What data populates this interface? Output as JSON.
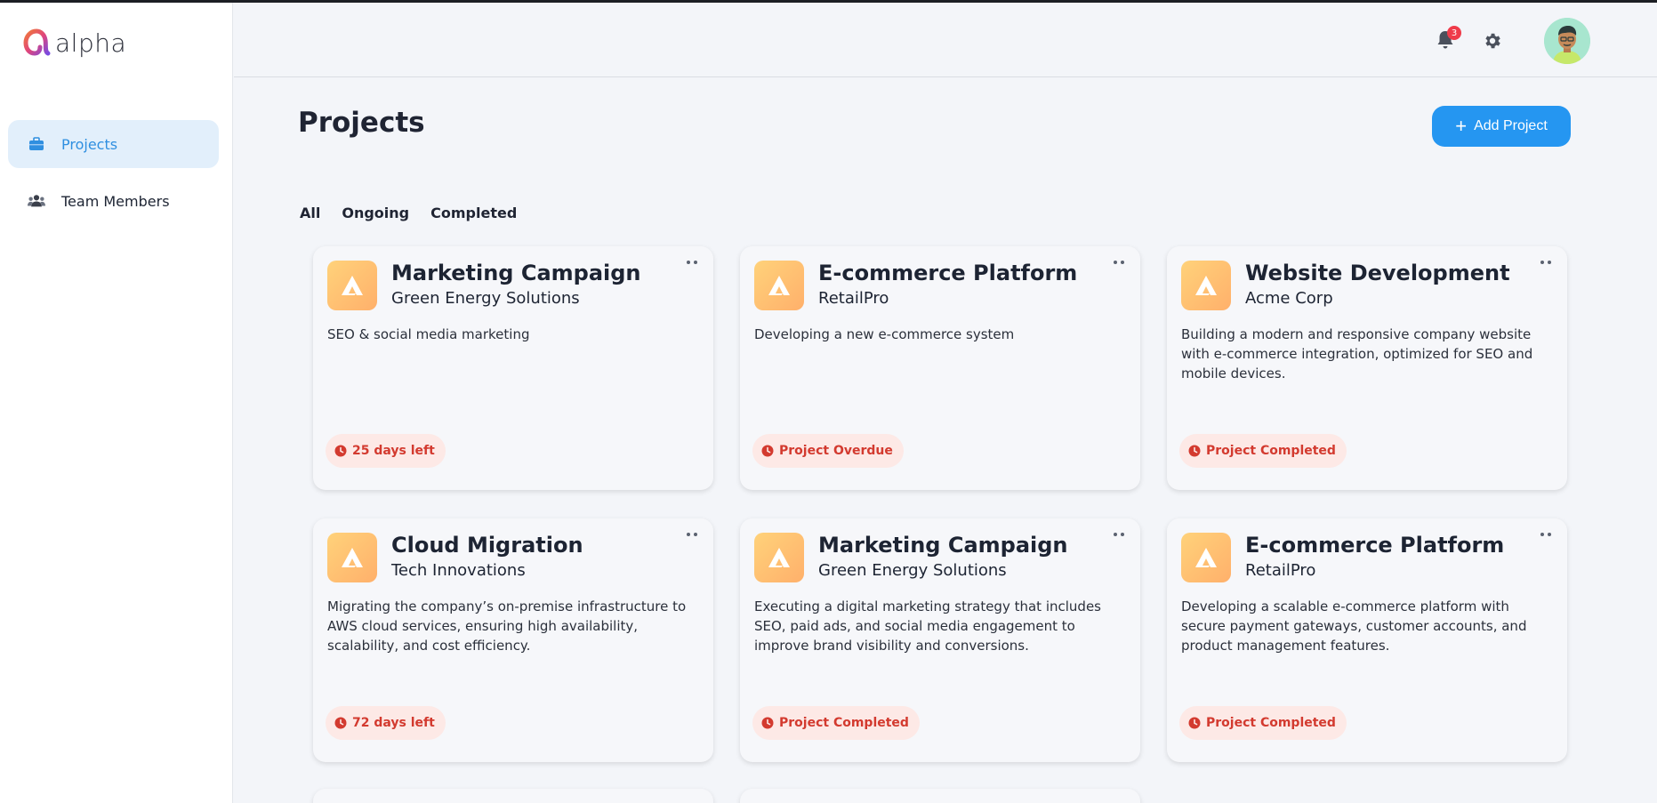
{
  "app": {
    "logo_text": "alpha"
  },
  "sidebar": {
    "items": [
      {
        "label": "Projects",
        "icon": "briefcase-icon",
        "active": true
      },
      {
        "label": "Team Members",
        "icon": "users-icon",
        "active": false
      }
    ]
  },
  "header": {
    "notification_count": "3",
    "icons": [
      "bell-icon",
      "gear-icon",
      "avatar"
    ]
  },
  "main": {
    "title": "Projects",
    "add_button_label": "Add Project",
    "tabs": [
      "All",
      "Ongoing",
      "Completed"
    ],
    "projects": [
      {
        "title": "Marketing Campaign",
        "client": "Green Energy Solutions",
        "description": "SEO & social media marketing",
        "status": "25 days left"
      },
      {
        "title": "E-commerce Platform",
        "client": "RetailPro",
        "description": "Developing a new e-commerce system",
        "status": "Project Overdue"
      },
      {
        "title": "Website Development",
        "client": "Acme Corp",
        "description": "Building a modern and responsive company website with e-commerce integration, optimized for SEO and mobile devices.",
        "status": "Project Completed"
      },
      {
        "title": "Cloud Migration",
        "client": "Tech Innovations",
        "description": "Migrating the company’s on-premise infrastructure to AWS cloud services, ensuring high availability, scalability, and cost efficiency.",
        "status": "72 days left"
      },
      {
        "title": "Marketing Campaign",
        "client": "Green Energy Solutions",
        "description": "Executing a digital marketing strategy that includes SEO, paid ads, and social media engagement to improve brand visibility and conversions.",
        "status": "Project Completed"
      },
      {
        "title": "E-commerce Platform",
        "client": "RetailPro",
        "description": "Developing a scalable e-commerce platform with secure payment gateways, customer accounts, and product management features.",
        "status": "Project Completed"
      }
    ]
  },
  "colors": {
    "accent": "#2596f1",
    "sidebar_active_bg": "#e2effb",
    "status_bg": "#fde9e6",
    "status_text": "#d33a2f",
    "badge": "#ef3b4a",
    "card_logo_gradient_start": "#ffd27a",
    "card_logo_gradient_end": "#ffb06b"
  }
}
